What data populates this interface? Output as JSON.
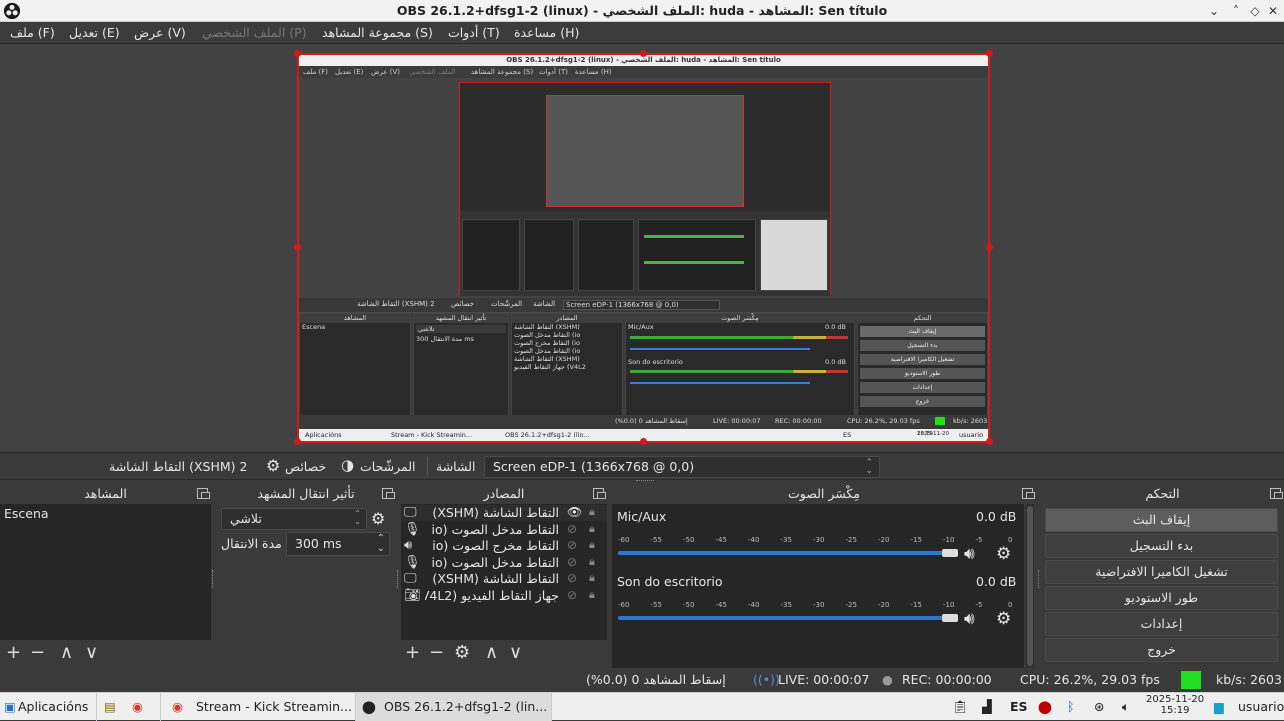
{
  "window": {
    "title": "OBS 26.1.2+dfsg1-2 (linux) - الملف الشخصي: huda - المشاهد: Sen título",
    "minimize": "⌄",
    "maximize": "˄",
    "restore": "◇",
    "close": "✕"
  },
  "menu": {
    "file": "ملف (F)",
    "edit": "تعديل (E)",
    "view": "عرض (V)",
    "profile": "الملف الشخصي (P)",
    "scene_collection": "مجموعة المشاهد (S)",
    "tools": "أدوات (T)",
    "help": "مساعدة (H)"
  },
  "nested": {
    "title": "OBS 26.1.2+dfsg1-2 (linux) - الملف الشخصي: huda - المشاهد: Sen título",
    "menu": [
      "ملف (F)",
      "تعديل (E)",
      "عرض (V)",
      "الملف الشخصي",
      "مجموعة المشاهد (S)",
      "أدوات (T)",
      "مساعدة (H)"
    ],
    "source_name": "التقاط الشاشة (XSHM) 2",
    "properties": "خصائص",
    "filters": "المرشّحات",
    "screen": "الشاشة",
    "screen_value": "Screen eDP-1 (1366x768 @ 0,0)",
    "scenes_header": "المشاهد",
    "scene_item": "Escena",
    "transitions_header": "تأثير انتقال المشهد",
    "fade": "تلاشي",
    "duration_label": "مدة الانتقال",
    "duration_value": "300 ms",
    "sources_header": "المصادر",
    "sources": [
      "التقاط الشاشة (XSHM)",
      "التقاط مدخل الصوت (io",
      "التقاط مخرج الصوت (io",
      "التقاط مدخل الصوت (io",
      "التقاط الشاشة (XSHM)",
      "جهاز التقاط الفيديو (V4L2"
    ],
    "mixer_header": "مِكْسَر الصوت",
    "mic": "Mic/Aux",
    "desktop": "Son do escritorio",
    "db": "0.0 dB",
    "controls_header": "التحكم",
    "controls": [
      "إيقاف البث",
      "بدء التسجيل",
      "تشغيل الكاميرا الافتراضية",
      "طور الاستوديو",
      "إعدادات",
      "خروج"
    ],
    "dropped": "إسقاط المشاهد 0 (0.0%)",
    "live": "LIVE: 00:00:07",
    "rec": "REC: 00:00:00",
    "cpu": "CPU: 26.2%, 29.03 fps",
    "kbs": "kb/s: 2603",
    "apps": "Aplicacións",
    "stream_tab": "Stream - Kick Streamin...",
    "obs_tab": "OBS 26.1.2+dfsg1-2 (lin...",
    "lang": "ES",
    "date": "2025-11-20",
    "time": "15:19",
    "user": "usuario"
  },
  "toolbar": {
    "source_name": "التقاط الشاشة (XSHM) 2",
    "properties": "خصائص",
    "filters": "المرشّحات",
    "screen_label": "الشاشة",
    "screen_value": "Screen eDP-1 (1366x768 @ 0,0)"
  },
  "scenes": {
    "header": "المشاهد",
    "items": [
      "Escena"
    ],
    "add": "+",
    "remove": "−",
    "up": "∧",
    "down": "∨"
  },
  "transitions": {
    "header": "تأثير انتقال المشهد",
    "selected": "تلاشي",
    "duration_label": "مدة الانتقال",
    "duration_value": "300 ms"
  },
  "sources": {
    "header": "المصادر",
    "items": [
      {
        "name": "التقاط الشاشة (XSHM)",
        "icon": "monitor-icon",
        "visible": true
      },
      {
        "name": "التقاط مدخل الصوت (io",
        "icon": "microphone-icon",
        "visible": false
      },
      {
        "name": "التقاط مخرج الصوت (io",
        "icon": "speaker-icon",
        "visible": false
      },
      {
        "name": "التقاط مدخل الصوت (io",
        "icon": "microphone-icon",
        "visible": false
      },
      {
        "name": "التقاط الشاشة (XSHM)",
        "icon": "monitor-icon",
        "visible": false
      },
      {
        "name": "جهاز التقاط الفيديو (V4L2",
        "icon": "camera-icon",
        "visible": false
      }
    ],
    "add": "+",
    "remove": "−",
    "gear": "⚙",
    "up": "∧",
    "down": "∨"
  },
  "mixer": {
    "header": "مِكْسَر الصوت",
    "ticks": [
      "-60",
      "-55",
      "-50",
      "-45",
      "-40",
      "-35",
      "-30",
      "-25",
      "-20",
      "-15",
      "-10",
      "-5",
      "0"
    ],
    "channels": [
      {
        "name": "Mic/Aux",
        "db": "0.0 dB",
        "level": 1.0
      },
      {
        "name": "Son do escritorio",
        "db": "0.0 dB",
        "level": 1.0
      }
    ]
  },
  "controls": {
    "header": "التحكم",
    "stop_streaming": "إيقاف البث",
    "start_recording": "بدء التسجيل",
    "start_virtual_cam": "تشغيل الكاميرا الافتراضية",
    "studio_mode": "طور الاستوديو",
    "settings": "إعدادات",
    "exit": "خروج"
  },
  "status": {
    "dropped": "إسقاط المشاهد 0 (0.0%)",
    "live": "LIVE: 00:00:07",
    "rec": "REC: 00:00:00",
    "cpu": "CPU: 26.2%, 29.03 fps",
    "kbs": "kb/s: 2603",
    "indicator_color": "#22dd22"
  },
  "taskbar": {
    "apps": "Aplicacións",
    "stream_window": "Stream - Kick Streamin...",
    "obs_window": "OBS 26.1.2+dfsg1-2 (lin...",
    "lang": "ES",
    "date": "2025-11-20",
    "time": "15:19",
    "user": "usuario"
  },
  "colors": {
    "accent": "#d21a1a",
    "meter_green": "#46b540",
    "slider_blue": "#2f76d0"
  }
}
